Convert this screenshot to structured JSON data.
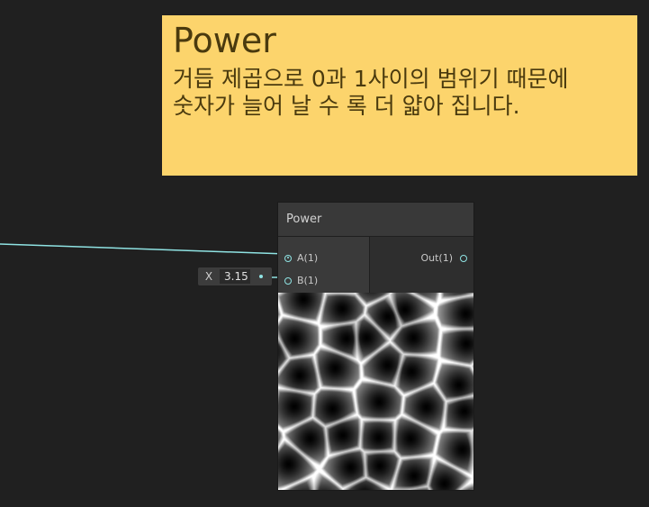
{
  "sticky_note": {
    "title": "Power",
    "body_lines": [
      "거듭 제곱으로 0과 1사이의 범위기 때문에",
      "숫자가 늘어 날 수 록 더 얇아 집니다."
    ],
    "color": "#fcd46c"
  },
  "node": {
    "title": "Power",
    "inputs": [
      {
        "label": "A(1)"
      },
      {
        "label": "B(1)"
      }
    ],
    "outputs": [
      {
        "label": "Out(1)"
      }
    ],
    "port_color": "#8fe3e3"
  },
  "inline_input": {
    "axis": "X",
    "value": "3.15"
  },
  "wire_color": "#8fe3e3"
}
